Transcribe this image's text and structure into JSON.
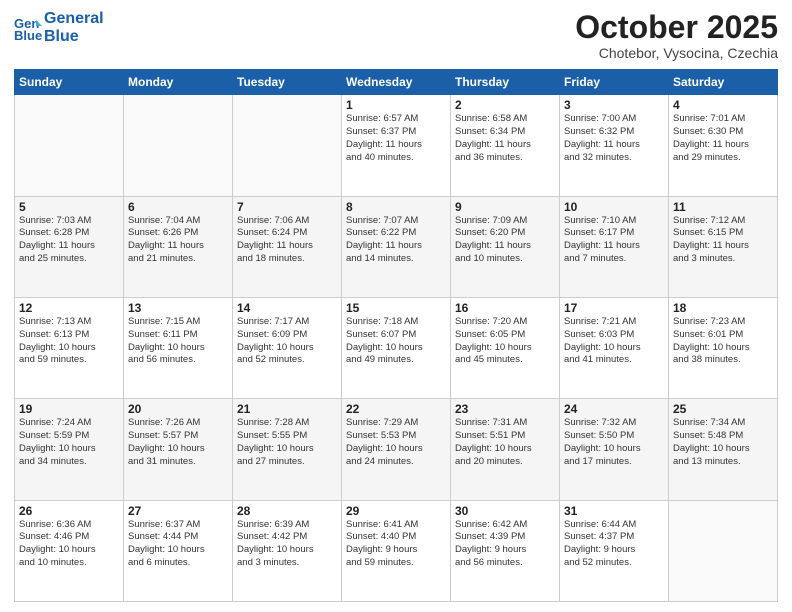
{
  "header": {
    "logo_line1": "General",
    "logo_line2": "Blue",
    "month": "October 2025",
    "location": "Chotebor, Vysocina, Czechia"
  },
  "weekdays": [
    "Sunday",
    "Monday",
    "Tuesday",
    "Wednesday",
    "Thursday",
    "Friday",
    "Saturday"
  ],
  "weeks": [
    [
      {
        "day": "",
        "text": ""
      },
      {
        "day": "",
        "text": ""
      },
      {
        "day": "",
        "text": ""
      },
      {
        "day": "1",
        "text": "Sunrise: 6:57 AM\nSunset: 6:37 PM\nDaylight: 11 hours\nand 40 minutes."
      },
      {
        "day": "2",
        "text": "Sunrise: 6:58 AM\nSunset: 6:34 PM\nDaylight: 11 hours\nand 36 minutes."
      },
      {
        "day": "3",
        "text": "Sunrise: 7:00 AM\nSunset: 6:32 PM\nDaylight: 11 hours\nand 32 minutes."
      },
      {
        "day": "4",
        "text": "Sunrise: 7:01 AM\nSunset: 6:30 PM\nDaylight: 11 hours\nand 29 minutes."
      }
    ],
    [
      {
        "day": "5",
        "text": "Sunrise: 7:03 AM\nSunset: 6:28 PM\nDaylight: 11 hours\nand 25 minutes."
      },
      {
        "day": "6",
        "text": "Sunrise: 7:04 AM\nSunset: 6:26 PM\nDaylight: 11 hours\nand 21 minutes."
      },
      {
        "day": "7",
        "text": "Sunrise: 7:06 AM\nSunset: 6:24 PM\nDaylight: 11 hours\nand 18 minutes."
      },
      {
        "day": "8",
        "text": "Sunrise: 7:07 AM\nSunset: 6:22 PM\nDaylight: 11 hours\nand 14 minutes."
      },
      {
        "day": "9",
        "text": "Sunrise: 7:09 AM\nSunset: 6:20 PM\nDaylight: 11 hours\nand 10 minutes."
      },
      {
        "day": "10",
        "text": "Sunrise: 7:10 AM\nSunset: 6:17 PM\nDaylight: 11 hours\nand 7 minutes."
      },
      {
        "day": "11",
        "text": "Sunrise: 7:12 AM\nSunset: 6:15 PM\nDaylight: 11 hours\nand 3 minutes."
      }
    ],
    [
      {
        "day": "12",
        "text": "Sunrise: 7:13 AM\nSunset: 6:13 PM\nDaylight: 10 hours\nand 59 minutes."
      },
      {
        "day": "13",
        "text": "Sunrise: 7:15 AM\nSunset: 6:11 PM\nDaylight: 10 hours\nand 56 minutes."
      },
      {
        "day": "14",
        "text": "Sunrise: 7:17 AM\nSunset: 6:09 PM\nDaylight: 10 hours\nand 52 minutes."
      },
      {
        "day": "15",
        "text": "Sunrise: 7:18 AM\nSunset: 6:07 PM\nDaylight: 10 hours\nand 49 minutes."
      },
      {
        "day": "16",
        "text": "Sunrise: 7:20 AM\nSunset: 6:05 PM\nDaylight: 10 hours\nand 45 minutes."
      },
      {
        "day": "17",
        "text": "Sunrise: 7:21 AM\nSunset: 6:03 PM\nDaylight: 10 hours\nand 41 minutes."
      },
      {
        "day": "18",
        "text": "Sunrise: 7:23 AM\nSunset: 6:01 PM\nDaylight: 10 hours\nand 38 minutes."
      }
    ],
    [
      {
        "day": "19",
        "text": "Sunrise: 7:24 AM\nSunset: 5:59 PM\nDaylight: 10 hours\nand 34 minutes."
      },
      {
        "day": "20",
        "text": "Sunrise: 7:26 AM\nSunset: 5:57 PM\nDaylight: 10 hours\nand 31 minutes."
      },
      {
        "day": "21",
        "text": "Sunrise: 7:28 AM\nSunset: 5:55 PM\nDaylight: 10 hours\nand 27 minutes."
      },
      {
        "day": "22",
        "text": "Sunrise: 7:29 AM\nSunset: 5:53 PM\nDaylight: 10 hours\nand 24 minutes."
      },
      {
        "day": "23",
        "text": "Sunrise: 7:31 AM\nSunset: 5:51 PM\nDaylight: 10 hours\nand 20 minutes."
      },
      {
        "day": "24",
        "text": "Sunrise: 7:32 AM\nSunset: 5:50 PM\nDaylight: 10 hours\nand 17 minutes."
      },
      {
        "day": "25",
        "text": "Sunrise: 7:34 AM\nSunset: 5:48 PM\nDaylight: 10 hours\nand 13 minutes."
      }
    ],
    [
      {
        "day": "26",
        "text": "Sunrise: 6:36 AM\nSunset: 4:46 PM\nDaylight: 10 hours\nand 10 minutes."
      },
      {
        "day": "27",
        "text": "Sunrise: 6:37 AM\nSunset: 4:44 PM\nDaylight: 10 hours\nand 6 minutes."
      },
      {
        "day": "28",
        "text": "Sunrise: 6:39 AM\nSunset: 4:42 PM\nDaylight: 10 hours\nand 3 minutes."
      },
      {
        "day": "29",
        "text": "Sunrise: 6:41 AM\nSunset: 4:40 PM\nDaylight: 9 hours\nand 59 minutes."
      },
      {
        "day": "30",
        "text": "Sunrise: 6:42 AM\nSunset: 4:39 PM\nDaylight: 9 hours\nand 56 minutes."
      },
      {
        "day": "31",
        "text": "Sunrise: 6:44 AM\nSunset: 4:37 PM\nDaylight: 9 hours\nand 52 minutes."
      },
      {
        "day": "",
        "text": ""
      }
    ]
  ]
}
